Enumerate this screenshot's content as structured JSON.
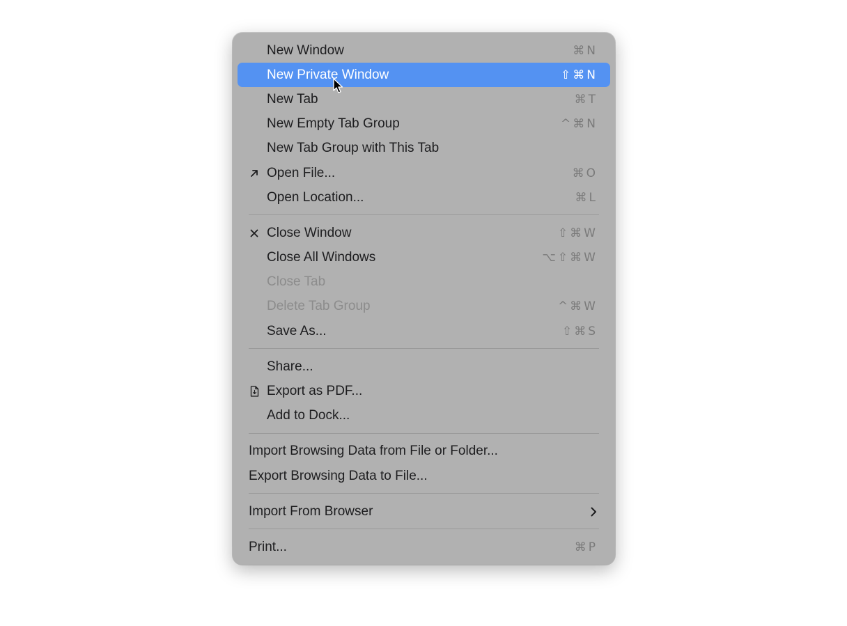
{
  "menu": {
    "new_window": {
      "label": "New Window",
      "shortcut": "⌘N"
    },
    "new_private_window": {
      "label": "New Private Window",
      "shortcut": "⇧⌘N"
    },
    "new_tab": {
      "label": "New Tab",
      "shortcut": "⌘T"
    },
    "new_empty_tab_group": {
      "label": "New Empty Tab Group",
      "shortcut": "^⌘N"
    },
    "new_tab_group_with_tab": {
      "label": "New Tab Group with This Tab"
    },
    "open_file": {
      "label": "Open File...",
      "shortcut": "⌘O",
      "icon": "arrow-up-right-icon"
    },
    "open_location": {
      "label": "Open Location...",
      "shortcut": "⌘L"
    },
    "close_window": {
      "label": "Close Window",
      "shortcut": "⇧⌘W",
      "icon": "close-x-icon"
    },
    "close_all_windows": {
      "label": "Close All Windows",
      "shortcut": "⌥⇧⌘W"
    },
    "close_tab": {
      "label": "Close Tab"
    },
    "delete_tab_group": {
      "label": "Delete Tab Group",
      "shortcut": "^⌘W"
    },
    "save_as": {
      "label": "Save As...",
      "shortcut": "⇧⌘S"
    },
    "share": {
      "label": "Share..."
    },
    "export_pdf": {
      "label": "Export as PDF...",
      "icon": "document-icon"
    },
    "add_to_dock": {
      "label": "Add to Dock..."
    },
    "import_browsing_data": {
      "label": "Import Browsing Data from File or Folder..."
    },
    "export_browsing_data": {
      "label": "Export Browsing Data to File..."
    },
    "import_from_browser": {
      "label": "Import From Browser",
      "icon": "chevron-right-icon"
    },
    "print": {
      "label": "Print...",
      "shortcut": "⌘P"
    }
  },
  "colors": {
    "menu_background": "#b1b1b1",
    "highlight": "#5492f2",
    "text": "#1d1d1f",
    "disabled_text": "#8c8c8c",
    "shortcut_text": "#7a7a7a"
  },
  "state": {
    "highlighted_item": "New Private Window",
    "disabled_items": [
      "Close Tab",
      "Delete Tab Group"
    ]
  }
}
